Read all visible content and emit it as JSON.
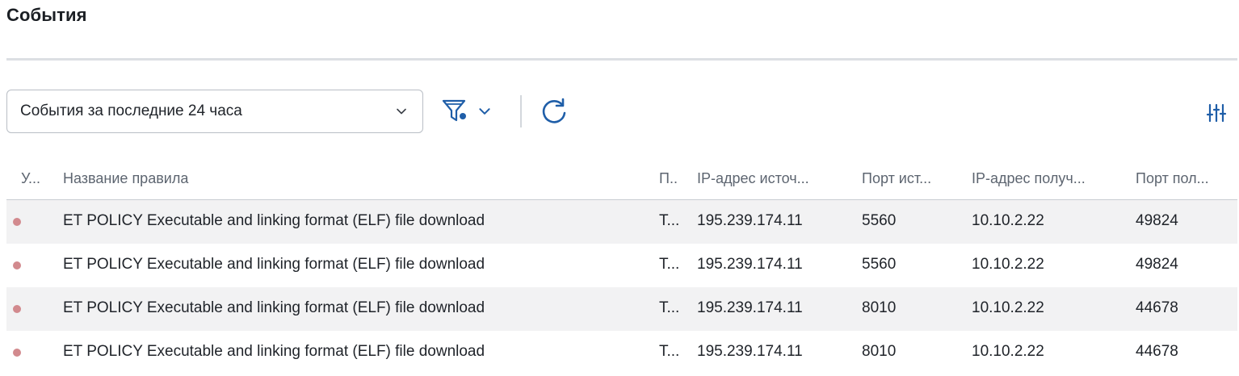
{
  "page": {
    "title": "События"
  },
  "toolbar": {
    "period_select": {
      "value": "События за последние 24 часа",
      "icon": "chevron-down-icon"
    },
    "filter_icon": "filter-icon",
    "filter_chevron_icon": "chevron-down-icon",
    "refresh_icon": "refresh-icon",
    "columns_settings_icon": "column-settings-icon",
    "accent_color": "#1f5ea8"
  },
  "table": {
    "columns": [
      "У...",
      "Название правила",
      "П..",
      "IP-адрес источ...",
      "Порт ист...",
      "IP-адрес получ...",
      "Порт пол..."
    ],
    "severity_color": "#d28a8e",
    "rows": [
      {
        "rule": "ET POLICY Executable and linking format (ELF) file download",
        "proto": "T...",
        "src_ip": "195.239.174.11",
        "src_port": "5560",
        "dst_ip": "10.10.2.22",
        "dst_port": "49824"
      },
      {
        "rule": "ET POLICY Executable and linking format (ELF) file download",
        "proto": "T...",
        "src_ip": "195.239.174.11",
        "src_port": "5560",
        "dst_ip": "10.10.2.22",
        "dst_port": "49824"
      },
      {
        "rule": "ET POLICY Executable and linking format (ELF) file download",
        "proto": "T...",
        "src_ip": "195.239.174.11",
        "src_port": "8010",
        "dst_ip": "10.10.2.22",
        "dst_port": "44678"
      },
      {
        "rule": "ET POLICY Executable and linking format (ELF) file download",
        "proto": "T...",
        "src_ip": "195.239.174.11",
        "src_port": "8010",
        "dst_ip": "10.10.2.22",
        "dst_port": "44678"
      }
    ]
  }
}
